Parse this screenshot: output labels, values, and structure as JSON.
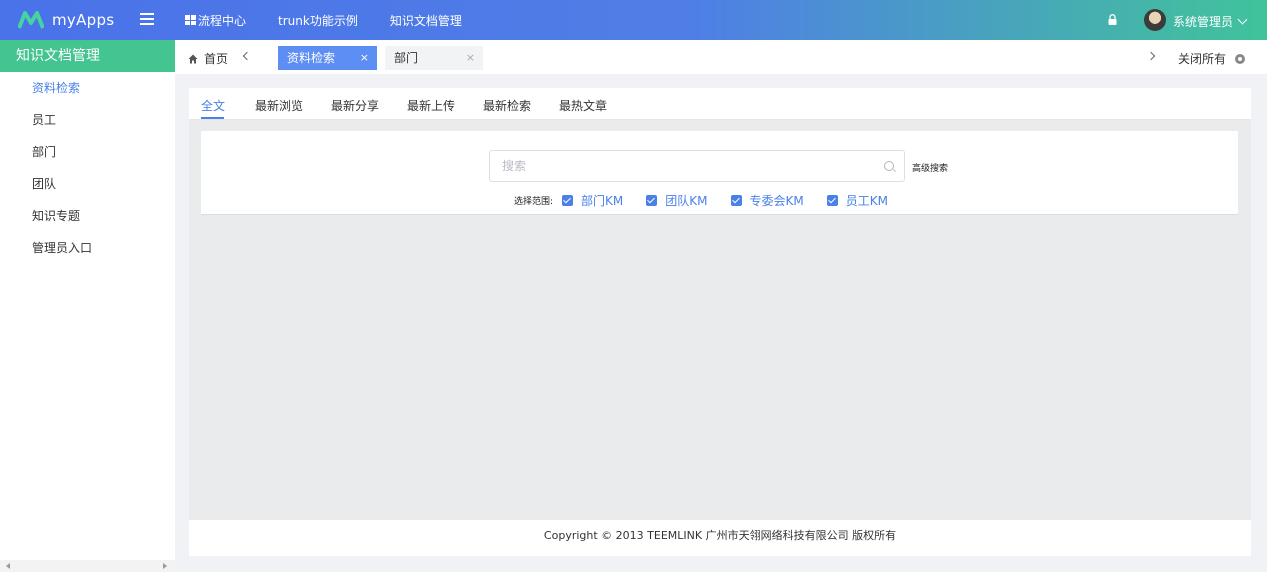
{
  "app": {
    "name": "myApps",
    "logo_icon": "m-logo-icon",
    "brand_color": "#4a72e9",
    "accent_green": "#44c58f"
  },
  "nav": [
    {
      "label": "流程中心",
      "icon": "grid-icon"
    },
    {
      "label": "trunk功能示例"
    },
    {
      "label": "知识文档管理"
    }
  ],
  "user": {
    "name": "系统管理员"
  },
  "sidebar": {
    "title": "知识文档管理",
    "items": [
      {
        "label": "资料检索",
        "active": true
      },
      {
        "label": "员工"
      },
      {
        "label": "部门"
      },
      {
        "label": "团队"
      },
      {
        "label": "知识专题"
      },
      {
        "label": "管理员入口"
      }
    ]
  },
  "tabs": {
    "home": "首页",
    "open": [
      {
        "label": "资料检索",
        "active": true,
        "close": "×"
      },
      {
        "label": "部门",
        "active": false,
        "close": "×"
      }
    ],
    "close_all": "关闭所有"
  },
  "content": {
    "subtabs": [
      "全文",
      "最新浏览",
      "最新分享",
      "最新上传",
      "最新检索",
      "最热文章"
    ],
    "search": {
      "placeholder": "搜索",
      "value": "",
      "advanced": "高级搜索"
    },
    "range": {
      "label": "选择范围:",
      "options": [
        {
          "label": "部门KM",
          "checked": true
        },
        {
          "label": "团队KM",
          "checked": true
        },
        {
          "label": "专委会KM",
          "checked": true
        },
        {
          "label": "员工KM",
          "checked": true
        }
      ]
    }
  },
  "footer": {
    "text": "Copyright © 2013 TEEMLINK 广州市天翎网络科技有限公司 版权所有"
  }
}
